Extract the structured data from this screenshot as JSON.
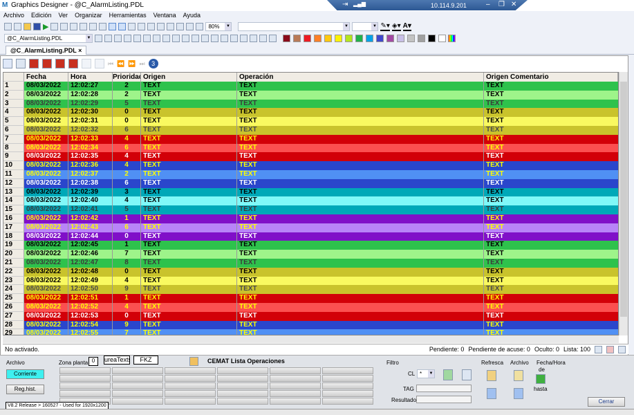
{
  "window": {
    "title": "Graphics Designer - @C_AlarmListing.PDL",
    "remote_ip": "10.114.9.201"
  },
  "menu": [
    "Archivo",
    "Edición",
    "Ver",
    "Organizar",
    "Herramientas",
    "Ventana",
    "Ayuda"
  ],
  "toolbar": {
    "zoom": "80%",
    "object_combo": "@C_AlarmListing.PDL"
  },
  "palette": [
    "#8b0a1a",
    "#b97a57",
    "#ed1c24",
    "#ff7f27",
    "#ffc90e",
    "#fff200",
    "#b5e61d",
    "#22b14c",
    "#00a2e8",
    "#3f48cc",
    "#a349a4",
    "#c8bfe7",
    "#c3c3c3",
    "#a0a0a0",
    "#000000",
    "#ffffff"
  ],
  "doc_tab": {
    "label": "@C_AlarmListing.PDL",
    "close": "×"
  },
  "table": {
    "headers": [
      "",
      "Fecha",
      "Hora",
      "Prioridad",
      "Origen",
      "Operación",
      "Origen Comentario"
    ],
    "rows": [
      {
        "n": "1",
        "fecha": "08/03/2022",
        "hora": "12:02:27",
        "prio": "2",
        "origen": "TEXT",
        "op": "TEXT",
        "com": "TEXT",
        "bg": "#2ec24c",
        "fg": "#000000"
      },
      {
        "n": "2",
        "fecha": "08/03/2022",
        "hora": "12:02:28",
        "prio": "2",
        "origen": "TEXT",
        "op": "TEXT",
        "com": "TEXT",
        "bg": "#9ef48a",
        "fg": "#000000"
      },
      {
        "n": "3",
        "fecha": "08/03/2022",
        "hora": "12:02:29",
        "prio": "5",
        "origen": "TEXT",
        "op": "TEXT",
        "com": "TEXT",
        "bg": "#2ec24c",
        "fg": "#3a3a3a"
      },
      {
        "n": "4",
        "fecha": "08/03/2022",
        "hora": "12:02:30",
        "prio": "0",
        "origen": "TEXT",
        "op": "TEXT",
        "com": "TEXT",
        "bg": "#c9c32c",
        "fg": "#000000"
      },
      {
        "n": "5",
        "fecha": "08/03/2022",
        "hora": "12:02:31",
        "prio": "0",
        "origen": "TEXT",
        "op": "TEXT",
        "com": "TEXT",
        "bg": "#f9f960",
        "fg": "#000000"
      },
      {
        "n": "6",
        "fecha": "08/03/2022",
        "hora": "12:02:32",
        "prio": "6",
        "origen": "TEXT",
        "op": "TEXT",
        "com": "TEXT",
        "bg": "#c9c32c",
        "fg": "#4a4a4a"
      },
      {
        "n": "7",
        "fecha": "08/03/2022",
        "hora": "12:02:33",
        "prio": "4",
        "origen": "TEXT",
        "op": "TEXT",
        "com": "TEXT",
        "bg": "#d20008",
        "fg": "#ffff00"
      },
      {
        "n": "8",
        "fecha": "08/03/2022",
        "hora": "12:02:34",
        "prio": "6",
        "origen": "TEXT",
        "op": "TEXT",
        "com": "TEXT",
        "bg": "#fb5050",
        "fg": "#ffff00"
      },
      {
        "n": "9",
        "fecha": "08/03/2022",
        "hora": "12:02:35",
        "prio": "4",
        "origen": "TEXT",
        "op": "TEXT",
        "com": "TEXT",
        "bg": "#d20008",
        "fg": "#ffffff"
      },
      {
        "n": "10",
        "fecha": "08/03/2022",
        "hora": "12:02:36",
        "prio": "4",
        "origen": "TEXT",
        "op": "TEXT",
        "com": "TEXT",
        "bg": "#2a46cc",
        "fg": "#ffff00"
      },
      {
        "n": "11",
        "fecha": "08/03/2022",
        "hora": "12:02:37",
        "prio": "2",
        "origen": "TEXT",
        "op": "TEXT",
        "com": "TEXT",
        "bg": "#5090f4",
        "fg": "#ffff00"
      },
      {
        "n": "12",
        "fecha": "08/03/2022",
        "hora": "12:02:38",
        "prio": "6",
        "origen": "TEXT",
        "op": "TEXT",
        "com": "TEXT",
        "bg": "#2a46cc",
        "fg": "#ffffff"
      },
      {
        "n": "13",
        "fecha": "08/03/2022",
        "hora": "12:02:39",
        "prio": "3",
        "origen": "TEXT",
        "op": "TEXT",
        "com": "TEXT",
        "bg": "#00a8b8",
        "fg": "#000000"
      },
      {
        "n": "14",
        "fecha": "08/03/2022",
        "hora": "12:02:40",
        "prio": "4",
        "origen": "TEXT",
        "op": "TEXT",
        "com": "TEXT",
        "bg": "#80f8f8",
        "fg": "#000000"
      },
      {
        "n": "15",
        "fecha": "08/03/2022",
        "hora": "12:02:41",
        "prio": "5",
        "origen": "TEXT",
        "op": "TEXT",
        "com": "TEXT",
        "bg": "#00a8b8",
        "fg": "#3a3a3a"
      },
      {
        "n": "16",
        "fecha": "08/03/2022",
        "hora": "12:02:42",
        "prio": "1",
        "origen": "TEXT",
        "op": "TEXT",
        "com": "TEXT",
        "bg": "#8010c8",
        "fg": "#ffff00"
      },
      {
        "n": "17",
        "fecha": "08/03/2022",
        "hora": "12:02:43",
        "prio": "6",
        "origen": "TEXT",
        "op": "TEXT",
        "com": "TEXT",
        "bg": "#b884f8",
        "fg": "#ffff00"
      },
      {
        "n": "18",
        "fecha": "08/03/2022",
        "hora": "12:02:44",
        "prio": "0",
        "origen": "TEXT",
        "op": "TEXT",
        "com": "TEXT",
        "bg": "#8010c8",
        "fg": "#ffffff"
      },
      {
        "n": "19",
        "fecha": "08/03/2022",
        "hora": "12:02:45",
        "prio": "1",
        "origen": "TEXT",
        "op": "TEXT",
        "com": "TEXT",
        "bg": "#2ec24c",
        "fg": "#000000"
      },
      {
        "n": "20",
        "fecha": "08/03/2022",
        "hora": "12:02:46",
        "prio": "7",
        "origen": "TEXT",
        "op": "TEXT",
        "com": "TEXT",
        "bg": "#9ef48a",
        "fg": "#000000"
      },
      {
        "n": "21",
        "fecha": "08/03/2022",
        "hora": "12:02:47",
        "prio": "8",
        "origen": "TEXT",
        "op": "TEXT",
        "com": "TEXT",
        "bg": "#2ec24c",
        "fg": "#3a3a3a"
      },
      {
        "n": "22",
        "fecha": "08/03/2022",
        "hora": "12:02:48",
        "prio": "0",
        "origen": "TEXT",
        "op": "TEXT",
        "com": "TEXT",
        "bg": "#c9c32c",
        "fg": "#000000"
      },
      {
        "n": "23",
        "fecha": "08/03/2022",
        "hora": "12:02:49",
        "prio": "4",
        "origen": "TEXT",
        "op": "TEXT",
        "com": "TEXT",
        "bg": "#f9f960",
        "fg": "#000000"
      },
      {
        "n": "24",
        "fecha": "08/03/2022",
        "hora": "12:02:50",
        "prio": "9",
        "origen": "TEXT",
        "op": "TEXT",
        "com": "TEXT",
        "bg": "#c9c32c",
        "fg": "#4a4a4a"
      },
      {
        "n": "25",
        "fecha": "08/03/2022",
        "hora": "12:02:51",
        "prio": "1",
        "origen": "TEXT",
        "op": "TEXT",
        "com": "TEXT",
        "bg": "#d20008",
        "fg": "#ffff00"
      },
      {
        "n": "26",
        "fecha": "08/03/2022",
        "hora": "12:02:52",
        "prio": "4",
        "origen": "TEXT",
        "op": "TEXT",
        "com": "TEXT",
        "bg": "#fb5050",
        "fg": "#ffff00"
      },
      {
        "n": "27",
        "fecha": "08/03/2022",
        "hora": "12:02:53",
        "prio": "0",
        "origen": "TEXT",
        "op": "TEXT",
        "com": "TEXT",
        "bg": "#d20008",
        "fg": "#ffffff"
      },
      {
        "n": "28",
        "fecha": "08/03/2022",
        "hora": "12:02:54",
        "prio": "9",
        "origen": "TEXT",
        "op": "TEXT",
        "com": "TEXT",
        "bg": "#2a46cc",
        "fg": "#ffff00"
      },
      {
        "n": "29",
        "fecha": "08/03/2022",
        "hora": "12:02:55",
        "prio": "7",
        "origen": "TEXT",
        "op": "TEXT",
        "com": "TEXT",
        "bg": "#5090f4",
        "fg": "#ffff00"
      }
    ]
  },
  "status": {
    "left": "No activado.",
    "pendiente": "Pendiente: 0",
    "pend_acuse": "Pendiente de acuse: 0",
    "oculto": "Oculto: 0",
    "lista": "Lista: 100"
  },
  "panel": {
    "archivo_label": "Archivo",
    "corriente": "Corriente",
    "reghist": "Reg.hist.",
    "zona_label": "Zona planta",
    "zona_value": "0",
    "area_texts": "ureaTexts",
    "fkz": "FKZ",
    "title": "CEMAT Lista Operaciones",
    "filtro": "Filtro",
    "cl": "CL",
    "cl_value": "*",
    "tag": "TAG",
    "resultado": "Resultado",
    "refresca": "Refresca",
    "archivo2": "Archivo",
    "fecha_hora": "Fecha/Hora",
    "de": "de",
    "hasta": "hasta",
    "cerrar": "Cerrar",
    "version": "V8.2 Release > 160527 - Used for 1920x1200"
  }
}
